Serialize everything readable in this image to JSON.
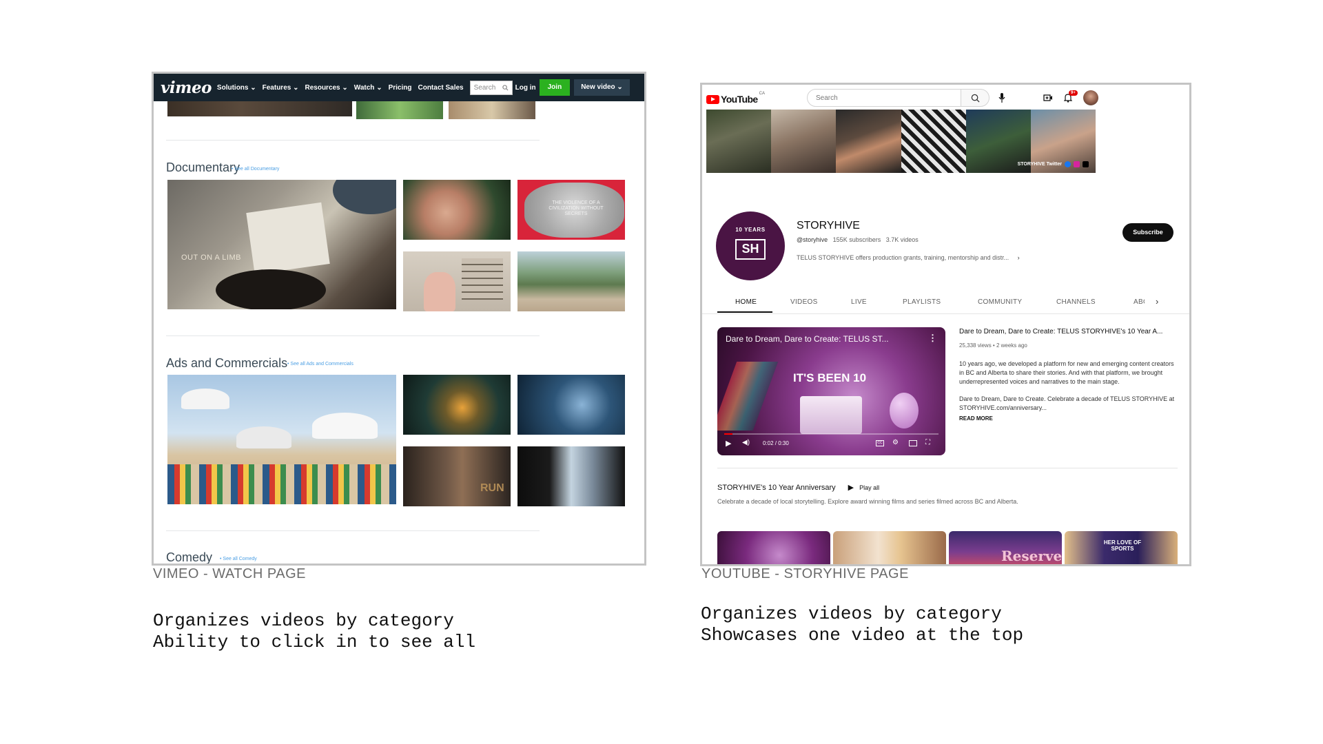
{
  "vimeo": {
    "caption": "VIMEO - WATCH PAGE",
    "nav": {
      "logo": "vimeo",
      "links": [
        "Solutions ⌄",
        "Features ⌄",
        "Resources ⌄",
        "Watch ⌄",
        "Pricing",
        "Contact Sales"
      ],
      "search_placeholder": "Search",
      "login": "Log in",
      "join": "Join",
      "new_video": "New video ⌄"
    },
    "sections": [
      {
        "title": "Documentary",
        "see_all": "• See all Documentary"
      },
      {
        "title": "Ads and Commercials",
        "see_all": "• See all Ads and Commercials"
      },
      {
        "title": "Comedy",
        "see_all": "• See all Comedy"
      }
    ],
    "thumb_text": {
      "out_on_a_limb": "OUT ON A LIMB",
      "violence": "THE VIOLENCE OF A CIVILIZATION WITHOUT SECRETS",
      "run": "RUN"
    },
    "notes": [
      "Organizes videos by category",
      "Ability to click in to see all"
    ]
  },
  "youtube": {
    "caption": "YOUTUBE - STORYHIVE PAGE",
    "logo": "YouTube",
    "logo_country": "CA",
    "search_placeholder": "Search",
    "notification_badge": "9+",
    "banner_social": "STORYHIVE Twitter",
    "channel": {
      "avatar_line1": "10 YEARS",
      "avatar_initials": "SH",
      "name": "STORYHIVE",
      "handle": "@storyhive",
      "subscribers": "155K subscribers",
      "videos": "3.7K videos",
      "description": "TELUS STORYHIVE offers production grants, training, mentorship and distr...",
      "subscribe": "Subscribe"
    },
    "tabs": [
      "HOME",
      "VIDEOS",
      "LIVE",
      "PLAYLISTS",
      "COMMUNITY",
      "CHANNELS",
      "ABO"
    ],
    "featured": {
      "player_title": "Dare to Dream, Dare to Create: TELUS ST...",
      "overlay_text": "IT'S BEEN 10",
      "time": "0:02 / 0:30",
      "title": "Dare to Dream, Dare to Create: TELUS STORYHIVE's 10 Year A...",
      "meta": "25,338 views • 2 weeks ago",
      "desc1": "10 years ago, we developed a platform for new and emerging content creators in BC and Alberta to share their stories. And with that platform, we brought underrepresented voices and narratives to the main stage.",
      "desc2": "Dare to Dream, Dare to Create. Celebrate a decade of TELUS STORYHIVE at STORYHIVE.com/anniversary...",
      "read_more": "READ MORE"
    },
    "playlist": {
      "title": "STORYHIVE's 10 Year Anniversary",
      "play_all": "Play all",
      "description": "Celebrate a decade of local storytelling. Explore award winning films and series filmed across BC and Alberta."
    },
    "strip_text": {
      "reserved": "Reserved",
      "her_love": "HER LOVE OF SPORTS"
    },
    "notes": [
      "Organizes videos by category",
      "Showcases one video at the top"
    ]
  },
  "colors": {
    "vimeo_nav": "#17242e",
    "vimeo_join": "#2bb11f",
    "youtube_red": "#ff0000",
    "storyhive_purple": "#4a1444"
  }
}
